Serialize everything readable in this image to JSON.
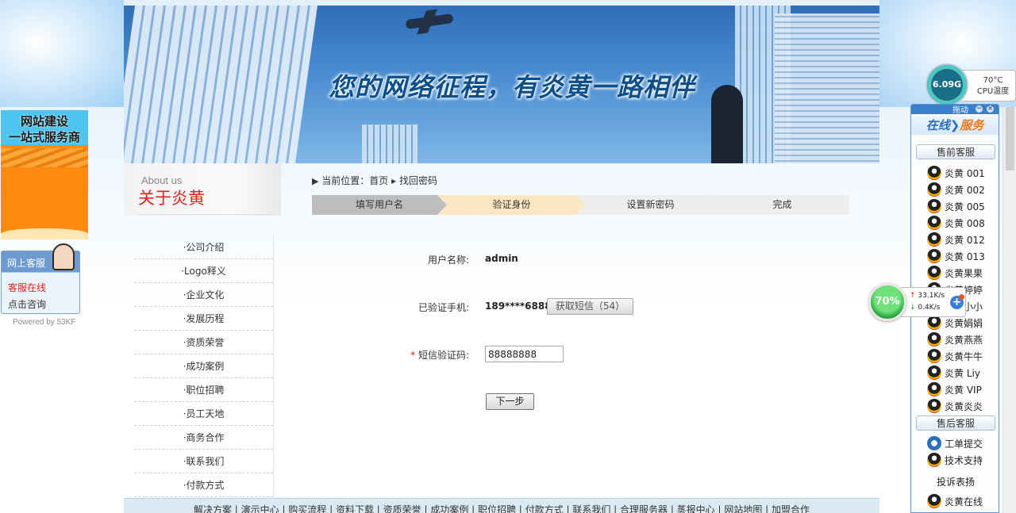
{
  "banner": {
    "slogan": "您的网络征程，有炎黄一路相伴"
  },
  "about": {
    "title_en": "About us",
    "title_cn": "关于炎黄"
  },
  "menu": [
    "·公司介绍",
    "·Logo释义",
    "·企业文化",
    "·发展历程",
    "·资质荣誉",
    "·成功案例",
    "·职位招聘",
    "·员工天地",
    "·商务合作",
    "·联系我们",
    "·付款方式"
  ],
  "breadcrumb": {
    "arrow": "▶",
    "text": "当前位置：首页",
    "sep": "▸",
    "current": "找回密码"
  },
  "steps": [
    "填写用户名",
    "验证身份",
    "设置新密码",
    "完成"
  ],
  "form": {
    "username_label": "用户名称:",
    "username_value": "admin",
    "phone_label": "已验证手机:",
    "phone_value": "189****6888",
    "sms_button": "获取短信（54）",
    "required_mark": "*",
    "code_label": "短信验证码:",
    "code_value": "88888888",
    "next_button": "下一步"
  },
  "footer": {
    "links": "解决方案 | 演示中心 | 购买流程 | 资料下载 | 资质荣誉 | 成功案例 | 职位招聘 | 付款方式 | 联系我们 | 合理服务器 | 蒸报中心 | 网站地图 | 加盟合作"
  },
  "left_ads": {
    "build_line1": "网站建设",
    "build_line2": "一站式服务商",
    "kf_header": "网上客服",
    "kf_line1": "客服在线",
    "kf_line2a": "点击",
    "kf_line2b": "咨询",
    "powered": "Powered by 53KF"
  },
  "service_panel": {
    "drag": "拖动",
    "title_a": "在线",
    "title_b": "服务",
    "presale_header": "售前客服",
    "presale": [
      "炎黄 001",
      "炎黄 002",
      "炎黄 005",
      "炎黄 008",
      "炎黄 012",
      "炎黄 013",
      "炎黄果果",
      "炎黄婷婷",
      "炎黄小小",
      "炎黄娟娟",
      "炎黄燕燕",
      "炎黄牛牛",
      "炎黄 Liy",
      "炎黄 VIP",
      "炎黄炎炎"
    ],
    "aftersale_header": "售后客服",
    "aftersale": [
      "工单提交",
      "技术支持"
    ],
    "complaint": "投诉表扬",
    "complaint_items": [
      "炎黄在线"
    ]
  },
  "cpu_widget": {
    "usage": "6.09G",
    "temp": "70°C",
    "label": "CPU温度"
  },
  "net_widget": {
    "percent": "70%",
    "up": "33.1K/s",
    "down": "0.4K/s",
    "up_icon": "↑",
    "down_icon": "↓",
    "plus": "+"
  }
}
